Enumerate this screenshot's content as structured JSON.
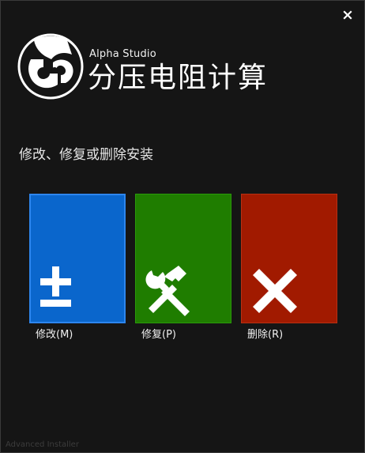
{
  "window": {
    "close_icon": "close-icon"
  },
  "header": {
    "brand": "Alpha Studio",
    "title": "分压电阻计算",
    "logo_icon": "alpha-studio-logo"
  },
  "subtitle": "修改、修复或删除安装",
  "actions": [
    {
      "label": "修改(M)",
      "icon": "plus-minus-icon",
      "color": "#0a66cc"
    },
    {
      "label": "修复(P)",
      "icon": "hammer-wrench-icon",
      "color": "#1f7d00"
    },
    {
      "label": "删除(R)",
      "icon": "x-icon",
      "color": "#a11a00"
    }
  ],
  "footer": "Advanced Installer"
}
